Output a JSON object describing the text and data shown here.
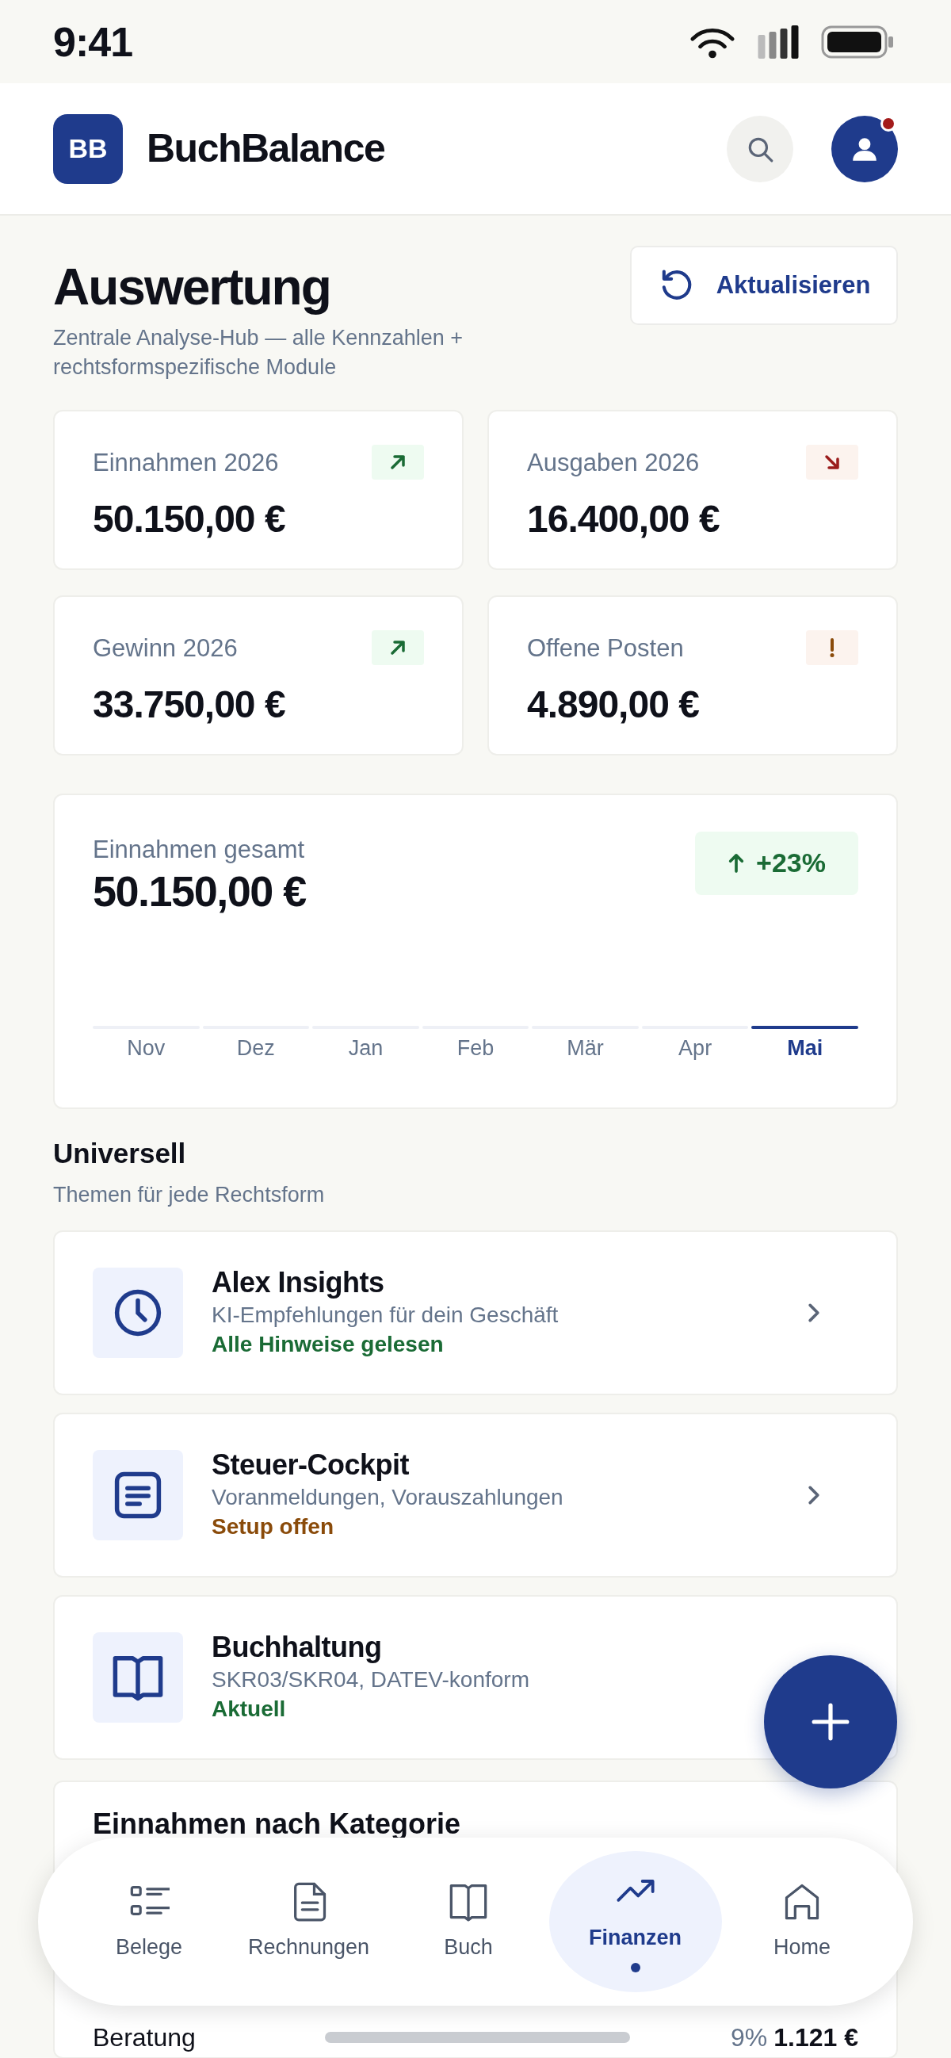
{
  "status_bar": {
    "time": "9:41"
  },
  "app_bar": {
    "logo": "BB",
    "title": "BuchBalance",
    "notification": true
  },
  "page": {
    "title": "Auswertung",
    "subtitle": "Zentrale Analyse-Hub — alle Kennzahlen + rechtsformspezifische Module",
    "refresh_button": "Aktualisieren"
  },
  "kpis": [
    {
      "label": "Einnahmen 2026",
      "value": "50.150,00 €",
      "kind": "up"
    },
    {
      "label": "Ausgaben 2026",
      "value": "16.400,00 €",
      "kind": "down"
    },
    {
      "label": "Gewinn 2026",
      "value": "33.750,00 €",
      "kind": "up"
    },
    {
      "label": "Offene Posten",
      "value": "4.890,00 €",
      "kind": "warning"
    }
  ],
  "revenue_chart": {
    "label": "Einnahmen gesamt",
    "value": "50.150,00 €",
    "change": "+23%",
    "months": [
      {
        "label": "Nov",
        "selected": false
      },
      {
        "label": "Dez",
        "selected": false
      },
      {
        "label": "Jan",
        "selected": false
      },
      {
        "label": "Feb",
        "selected": false
      },
      {
        "label": "Mär",
        "selected": false
      },
      {
        "label": "Apr",
        "selected": false
      },
      {
        "label": "Mai",
        "selected": true
      }
    ]
  },
  "section": {
    "title": "Universell",
    "subtitle": "Themen für jede Rechtsform"
  },
  "modules": [
    {
      "kind": "insights",
      "title": "Alex Insights",
      "description": "KI-Empfehlungen für dein Geschäft",
      "status": {
        "text": "Alle Hinweise gelesen",
        "color": "#1a6b35"
      },
      "chevron": true
    },
    {
      "kind": "tax",
      "title": "Steuer-Cockpit",
      "description": "Voranmeldungen, Vorauszahlungen",
      "status": {
        "text": "Setup offen",
        "color": "#8a4b0a"
      },
      "chevron": true
    },
    {
      "kind": "ledger",
      "title": "Buchhaltung",
      "description": "SKR03/SKR04, DATEV-konform",
      "status": {
        "text": "Aktuell",
        "color": "#1a6b35"
      },
      "chevron": false
    }
  ],
  "category_card": {
    "title": "Einnahmen nach Kategorie",
    "rows": [
      {
        "name": "Beratung",
        "share": "9%",
        "amount": "1.121 €"
      }
    ]
  },
  "bottom_nav": [
    {
      "label": "Belege",
      "kind": "list",
      "selected": false
    },
    {
      "label": "Rechnungen",
      "kind": "file",
      "selected": false
    },
    {
      "label": "Buch",
      "kind": "book",
      "selected": false
    },
    {
      "label": "Finanzen",
      "kind": "trend",
      "selected": true
    },
    {
      "label": "Home",
      "kind": "home",
      "selected": false
    }
  ]
}
